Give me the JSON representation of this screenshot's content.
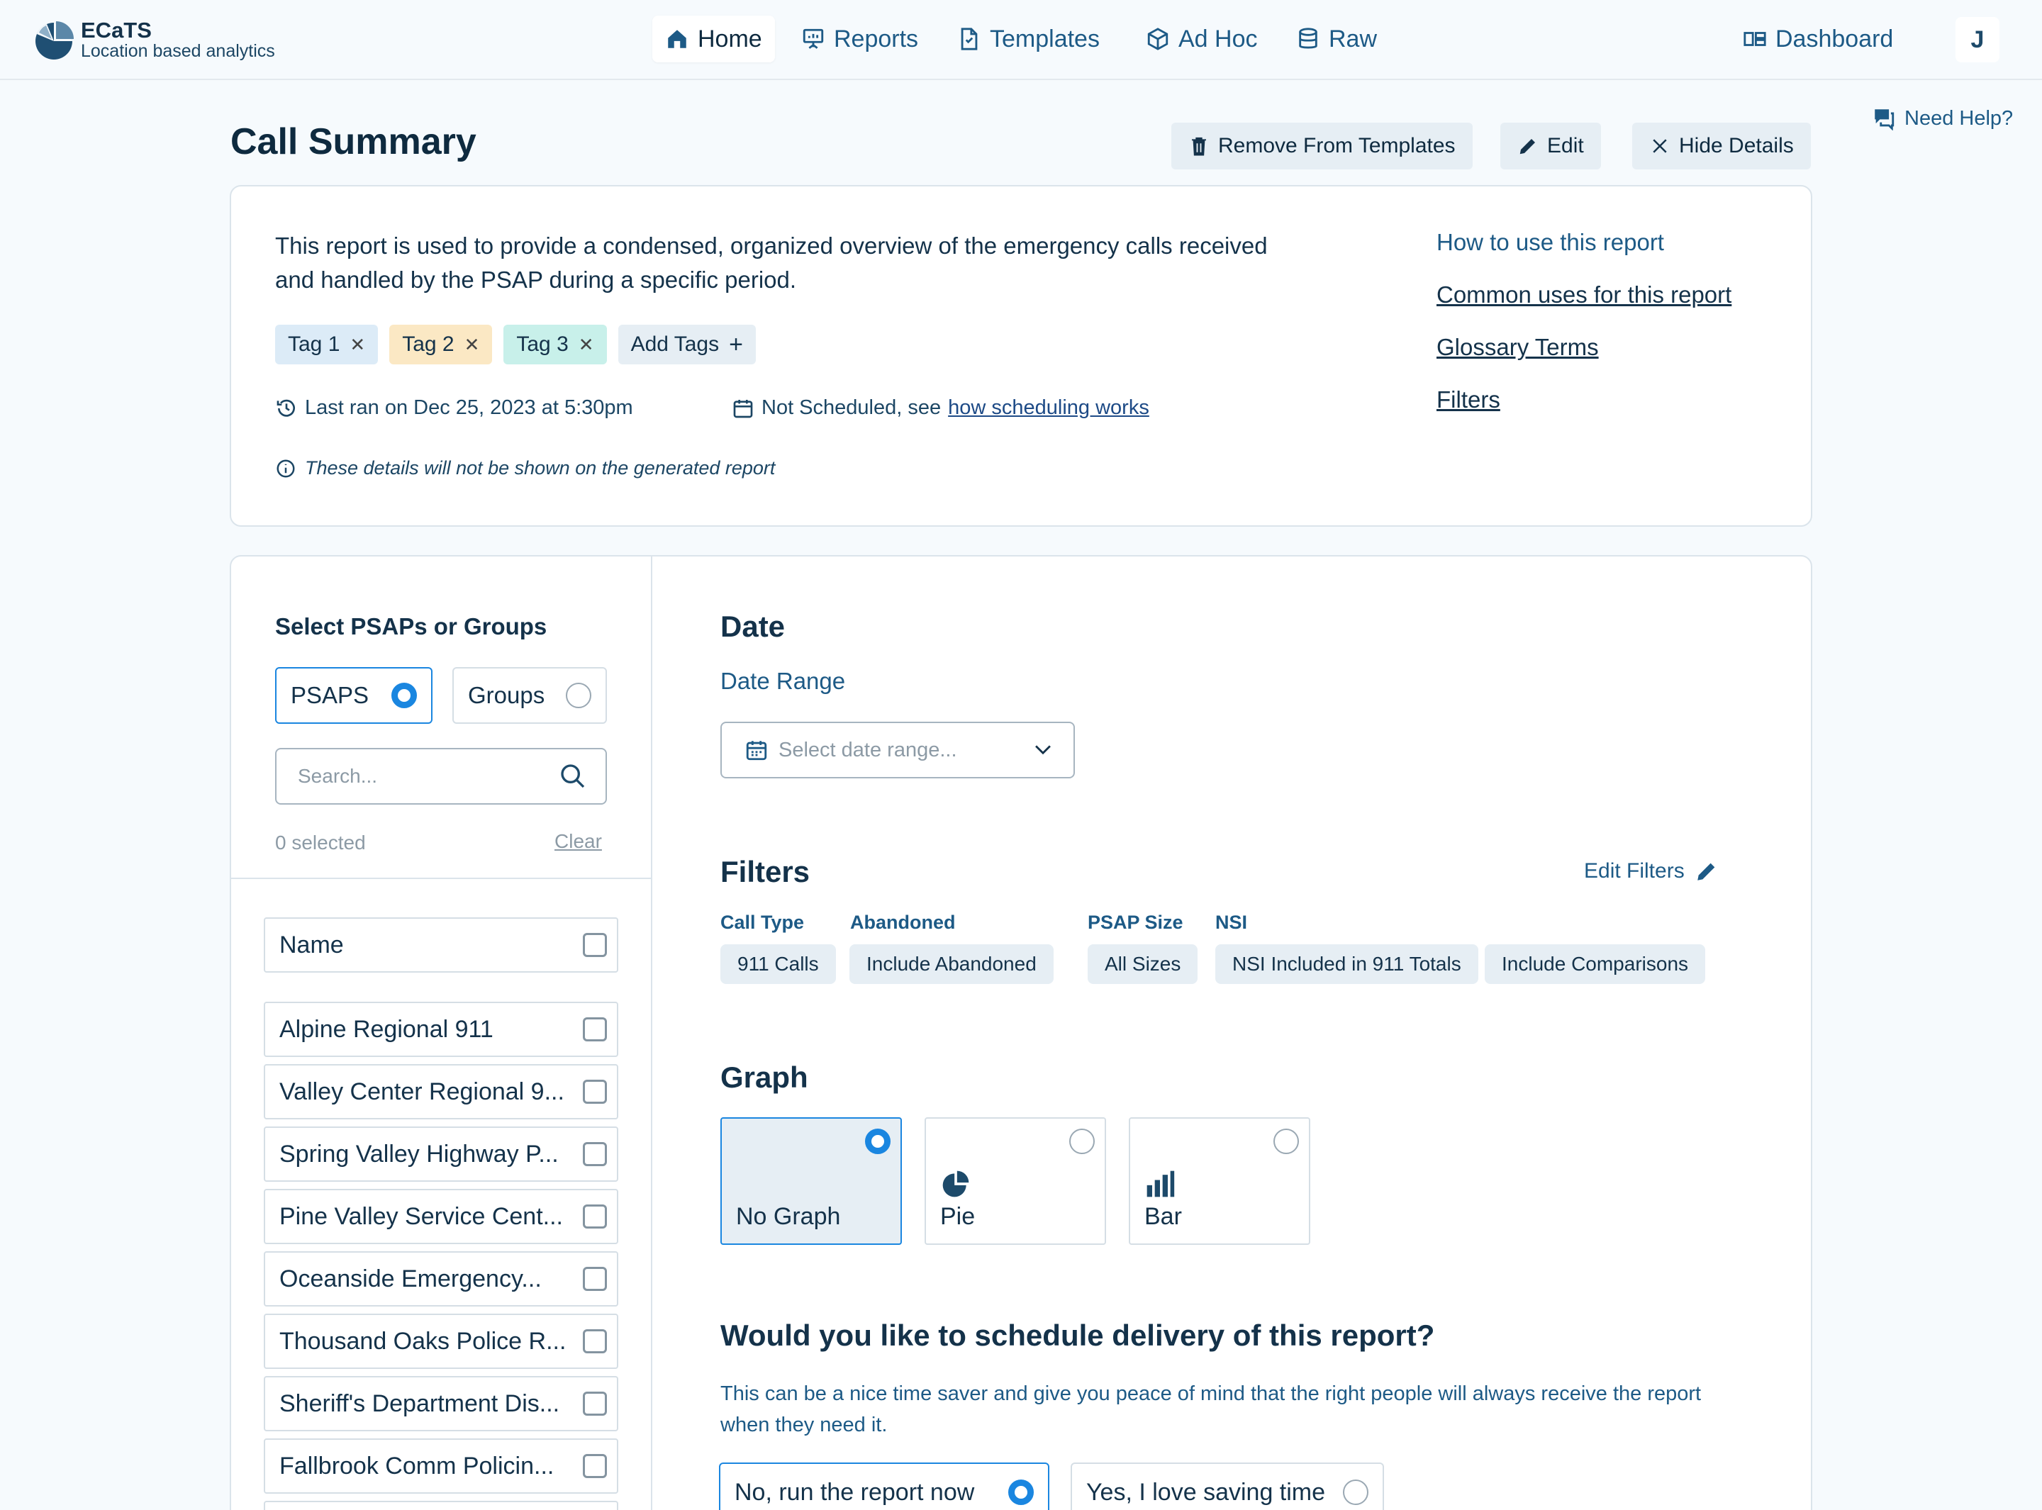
{
  "app": {
    "name": "ECaTS",
    "tagline": "Location based analytics"
  },
  "nav": {
    "items": [
      {
        "label": "Home",
        "icon": "home-icon"
      },
      {
        "label": "Reports",
        "icon": "presentation-icon"
      },
      {
        "label": "Templates",
        "icon": "document-icon"
      },
      {
        "label": "Ad Hoc",
        "icon": "cube-icon"
      },
      {
        "label": "Raw",
        "icon": "database-icon"
      }
    ],
    "dashboard": "Dashboard",
    "user_initial": "J"
  },
  "help": "Need Help?",
  "page": {
    "title": "Call Summary",
    "actions": {
      "remove": "Remove From Templates",
      "edit": "Edit",
      "hide": "Hide Details"
    }
  },
  "details": {
    "description": "This report is used to provide a condensed, organized overview of the emergency calls received and handled by the PSAP during a specific period.",
    "tags": [
      {
        "label": "Tag 1",
        "color": "#dcebf7"
      },
      {
        "label": "Tag 2",
        "color": "#fbe8c4"
      },
      {
        "label": "Tag 3",
        "color": "#c8f0ea"
      }
    ],
    "add_tags": "Add Tags",
    "last_ran": "Last ran on Dec 25, 2023 at 5:30pm",
    "schedule_text": "Not Scheduled, see",
    "schedule_link": "how scheduling works",
    "note": "These details will not be shown on the generated report",
    "links": [
      "How to use this report",
      "Common uses for this report",
      "Glossary Terms",
      "Filters"
    ]
  },
  "psap_panel": {
    "title": "Select PSAPs or Groups",
    "options": [
      "PSAPS",
      "Groups"
    ],
    "selected_option": "PSAPS",
    "search_placeholder": "Search...",
    "selected_count": "0 selected",
    "clear": "Clear",
    "header": "Name",
    "items": [
      "Alpine Regional 911",
      "Valley Center Regional 9...",
      "Spring Valley Highway P...",
      "Pine Valley Service Cent...",
      "Oceanside Emergency...",
      "Thousand Oaks Police R...",
      "Sheriff's Department Dis...",
      "Fallbrook Comm Policin..."
    ]
  },
  "date": {
    "title": "Date",
    "range_label": "Date Range",
    "placeholder": "Select date range..."
  },
  "filters": {
    "title": "Filters",
    "edit": "Edit Filters",
    "groups": [
      {
        "label": "Call Type",
        "values": [
          "911 Calls"
        ]
      },
      {
        "label": "Abandoned",
        "values": [
          "Include Abandoned"
        ]
      },
      {
        "label": "PSAP Size",
        "values": [
          "All Sizes"
        ]
      },
      {
        "label": "NSI",
        "values": [
          "NSI Included in 911 Totals",
          "Include Comparisons"
        ]
      }
    ]
  },
  "graph": {
    "title": "Graph",
    "options": [
      "No Graph",
      "Pie",
      "Bar"
    ],
    "selected": "No Graph"
  },
  "schedule": {
    "title": "Would you like to schedule delivery of this report?",
    "description": "This can be a nice time saver and give you peace of mind that the right people will always receive the report when they need it.",
    "options": [
      "No, run the report now",
      "Yes, I love saving time"
    ],
    "selected": "No, run the report now"
  },
  "colors": {
    "accent": "#1a86e0",
    "link": "#1d5a86",
    "text": "#0e2a3f",
    "background": "#f6fafd"
  }
}
